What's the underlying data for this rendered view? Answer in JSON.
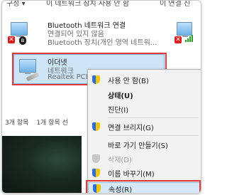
{
  "topbar": {
    "crumbs": [
      "구성 ▾",
      "이 네트워크 장치 사용 안 함",
      "이 연결 진"
    ]
  },
  "connections": {
    "bluetooth": {
      "name": "Bluetooth 네트워크 연결",
      "status": "연결되어 있지 않음",
      "device": "Bluetooth 장치(개인 영역 네트워..."
    },
    "ethernet": {
      "name": "이더넷",
      "status": "네트워크",
      "device": "Realtek PCI"
    }
  },
  "statusbar": {
    "count": "3개 항목",
    "selected": "1개 항목 선"
  },
  "context_menu": {
    "items": [
      {
        "label": "사용 안 함(B)",
        "icon": "shield-icon",
        "bold": false,
        "disabled": false
      },
      {
        "label": "상태(U)",
        "icon": "",
        "bold": true,
        "disabled": false
      },
      {
        "label": "진단(I)",
        "icon": "",
        "bold": false,
        "disabled": false
      },
      {
        "label": "연결 브리지(G)",
        "icon": "shield-icon",
        "bold": false,
        "disabled": false
      },
      {
        "label": "바로 가기 만들기(S)",
        "icon": "",
        "bold": false,
        "disabled": false
      },
      {
        "label": "삭제(D)",
        "icon": "shield-icon",
        "bold": false,
        "disabled": true
      },
      {
        "label": "이름 바꾸기(M)",
        "icon": "shield-icon",
        "bold": false,
        "disabled": false
      },
      {
        "label": "속성(R)",
        "icon": "shield-icon",
        "bold": false,
        "disabled": false
      }
    ]
  },
  "colors": {
    "highlight_box": "#e23b3b",
    "selection_fill": "#cde5f7",
    "menu_bg": "#f2f2f2"
  }
}
